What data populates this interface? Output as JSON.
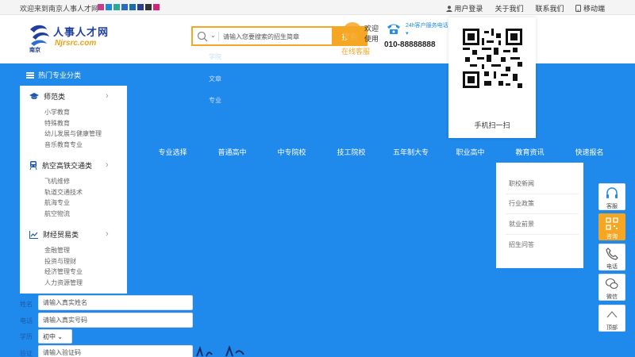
{
  "topbar": {
    "welcome": "欢迎来到南京人事人才网",
    "swatches": [
      "#c83c8c",
      "#1b8ad6",
      "#2aa89a",
      "#2a69c4",
      "#196ea8",
      "#2d3e8c",
      "#333333",
      "#d2257a"
    ],
    "links": {
      "user_login": "用户登录",
      "about": "关于我们",
      "contact": "联系我们",
      "mobile": "移动端"
    }
  },
  "logo": {
    "title": "人事人才网",
    "domain": "Njrsrc.com",
    "city": "南京"
  },
  "search": {
    "placeholder": "请输入您要搜索的招生简章",
    "button": "搜索",
    "online": "在线客服"
  },
  "welcome_side": {
    "line1": "欢迎",
    "line2": "使用"
  },
  "hotline": {
    "label": "24h客户服务电话",
    "number": "010-88888888"
  },
  "qr": {
    "label": "手机扫一扫"
  },
  "sub_links": [
    "学院",
    "文章",
    "专业"
  ],
  "hot_categories": "热门专业分类",
  "categories": [
    {
      "name": "师范类",
      "items": [
        "小学教育",
        "特殊教育",
        "幼儿发展与健康管理",
        "音乐教育专业"
      ]
    },
    {
      "name": "航空高铁交通类",
      "items": [
        "飞机维修",
        "轨道交通技术",
        "航海专业",
        "航空物流"
      ]
    },
    {
      "name": "财经贸易类",
      "items": [
        "金融管理",
        "投资与理财",
        "经济管理专业",
        "人力资源管理"
      ]
    }
  ],
  "nav": [
    "专业选择",
    "普通高中",
    "中专院校",
    "技工院校",
    "五年制大专",
    "职业高中",
    "教育资讯",
    "快速报名"
  ],
  "dropdown": [
    "职校新闻",
    "行业政策",
    "就业前景",
    "招生问答"
  ],
  "form": {
    "name_label": "姓名",
    "name_placeholder": "请输入真实姓名",
    "phone_label": "电话",
    "phone_placeholder": "请输入真实号码",
    "edu_label": "学历",
    "edu_value": "初中",
    "code_label": "验证",
    "code_placeholder": "请输入验证码"
  },
  "sidebar_tools": {
    "service": "客服",
    "consult": "咨询",
    "phone": "电话",
    "wechat": "微信",
    "top": "顶部"
  },
  "colors": {
    "brand_blue": "#2089ec",
    "accent_orange": "#f5a623"
  }
}
